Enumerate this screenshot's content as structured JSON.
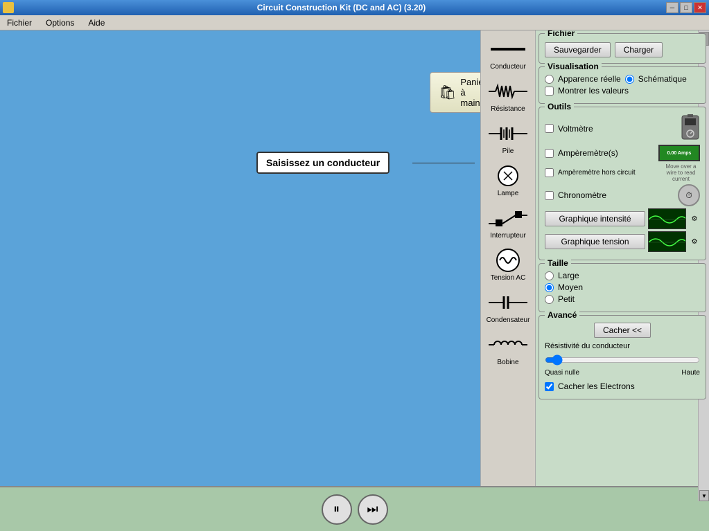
{
  "window": {
    "title": "Circuit Construction Kit (DC and AC) (3.20)",
    "icon": "circuit-icon"
  },
  "menubar": {
    "items": [
      {
        "label": "Fichier"
      },
      {
        "label": "Options"
      },
      {
        "label": "Aide"
      }
    ]
  },
  "canvas": {
    "tooltip": "Saisissez un conducteur"
  },
  "panier": {
    "label": "Panier à main"
  },
  "components": [
    {
      "id": "conducteur",
      "label": "Conducteur"
    },
    {
      "id": "resistance",
      "label": "Résistance"
    },
    {
      "id": "pile",
      "label": "Pile"
    },
    {
      "id": "lampe",
      "label": "Lampe"
    },
    {
      "id": "interrupteur",
      "label": "Interrupteur"
    },
    {
      "id": "tension-ac",
      "label": "Tension AC"
    },
    {
      "id": "condensateur",
      "label": "Condensateur"
    },
    {
      "id": "bobine",
      "label": "Bobine"
    }
  ],
  "fichier_section": {
    "title": "Fichier",
    "sauvegarder": "Sauvegarder",
    "charger": "Charger"
  },
  "visualisation_section": {
    "title": "Visualisation",
    "apparence_reelle": "Apparence réelle",
    "schematique": "Schématique",
    "schematique_selected": true,
    "montrer_valeurs": "Montrer les valeurs",
    "montrer_valeurs_checked": false
  },
  "outils_section": {
    "title": "Outils",
    "voltmetre": {
      "label": "Voltmètre",
      "checked": false
    },
    "amperemetre": {
      "label": "Ampèremètre(s)",
      "checked": false,
      "value": "0.00 Amps"
    },
    "amperemetre_hors": {
      "label": "Ampèremètre hors circuit",
      "checked": false
    },
    "chronometre": {
      "label": "Chronomètre",
      "checked": false
    },
    "graphique_intensite": "Graphique intensité",
    "graphique_tension": "Graphique tension"
  },
  "taille_section": {
    "title": "Taille",
    "large": "Large",
    "moyen": "Moyen",
    "moyen_selected": true,
    "petit": "Petit"
  },
  "avance_section": {
    "title": "Avancé",
    "cacher": "Cacher <<",
    "resistivite": "Résistivité du conducteur",
    "quasi_nulle": "Quasi nulle",
    "haute": "Haute",
    "cacher_electrons": "Cacher les Electrons",
    "cacher_electrons_checked": true
  },
  "controls": {
    "pause_icon": "⏸",
    "next_icon": "⏭"
  },
  "titlebar_buttons": {
    "minimize": "─",
    "maximize": "□",
    "close": "✕"
  }
}
